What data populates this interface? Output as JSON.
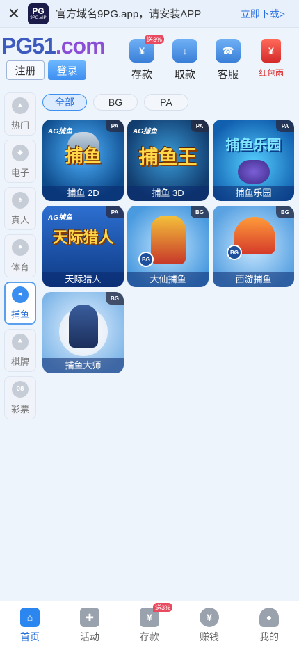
{
  "banner": {
    "close_icon": "close-icon",
    "app_logo_line1": "PG",
    "app_logo_line2": "9PG.VIP",
    "message": "官方域名9PG.app，请安装APP",
    "download": "立即下载>"
  },
  "header": {
    "logo_a": "PG51",
    "logo_b": ".com",
    "register": "注册",
    "login": "登录",
    "quick": [
      {
        "label": "存款",
        "icon": "deposit-card-icon",
        "tag": "送3%"
      },
      {
        "label": "取款",
        "icon": "withdraw-card-icon"
      },
      {
        "label": "客服",
        "icon": "customer-service-icon"
      },
      {
        "label": "红包雨",
        "icon": "red-envelope-icon"
      }
    ]
  },
  "sidebar": {
    "items": [
      {
        "label": "热门",
        "icon": "flame-icon"
      },
      {
        "label": "电子",
        "icon": "gamepad-icon"
      },
      {
        "label": "真人",
        "icon": "live-dealer-icon"
      },
      {
        "label": "体育",
        "icon": "soccer-ball-icon"
      },
      {
        "label": "捕鱼",
        "icon": "fish-icon"
      },
      {
        "label": "棋牌",
        "icon": "cards-icon"
      },
      {
        "label": "彩票",
        "icon": "lottery-ball-icon",
        "icon_text": "08"
      }
    ],
    "active": "捕鱼"
  },
  "filters": {
    "tabs": [
      "全部",
      "BG",
      "PA"
    ],
    "active": "全部"
  },
  "games": [
    {
      "name": "捕鱼 2D",
      "provider": "AG捕鱼",
      "badge": "PA",
      "art_title": "捕鱼"
    },
    {
      "name": "捕鱼 3D",
      "provider": "AG捕鱼",
      "badge": "PA",
      "art_title": "捕鱼王"
    },
    {
      "name": "捕鱼乐园",
      "provider": "",
      "badge": "PA",
      "art_title": "捕鱼乐园"
    },
    {
      "name": "天际猎人",
      "provider": "AG捕鱼",
      "badge": "PA",
      "art_title": "天际猎人"
    },
    {
      "name": "大仙捕鱼",
      "provider": "",
      "badge": "BG",
      "art_title": ""
    },
    {
      "name": "西游捕鱼",
      "provider": "",
      "badge": "BG",
      "art_title": ""
    },
    {
      "name": "捕鱼大师",
      "provider": "",
      "badge": "BG",
      "art_title": ""
    }
  ],
  "bottom_nav": {
    "items": [
      {
        "label": "首页",
        "icon": "home-icon"
      },
      {
        "label": "活动",
        "icon": "gift-icon"
      },
      {
        "label": "存款",
        "icon": "money-bag-icon",
        "tag": "送3%"
      },
      {
        "label": "赚钱",
        "icon": "yuan-coin-icon"
      },
      {
        "label": "我的",
        "icon": "user-icon"
      }
    ],
    "active": "首页"
  },
  "colors": {
    "accent": "#2b86f0",
    "page_bg": "#eef4fb",
    "tag_red": "#e84a5f"
  }
}
